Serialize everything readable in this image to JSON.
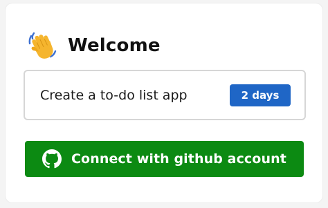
{
  "header": {
    "title": "Welcome",
    "icon": "waving-hand-icon"
  },
  "task": {
    "title": "Create a to-do list app",
    "duration": "2 days"
  },
  "github_button": {
    "label": "Connect with github account",
    "icon": "github-icon"
  },
  "colors": {
    "badge": "#1f66c6",
    "button": "#0c8a12",
    "wave": "#f5b52e"
  }
}
